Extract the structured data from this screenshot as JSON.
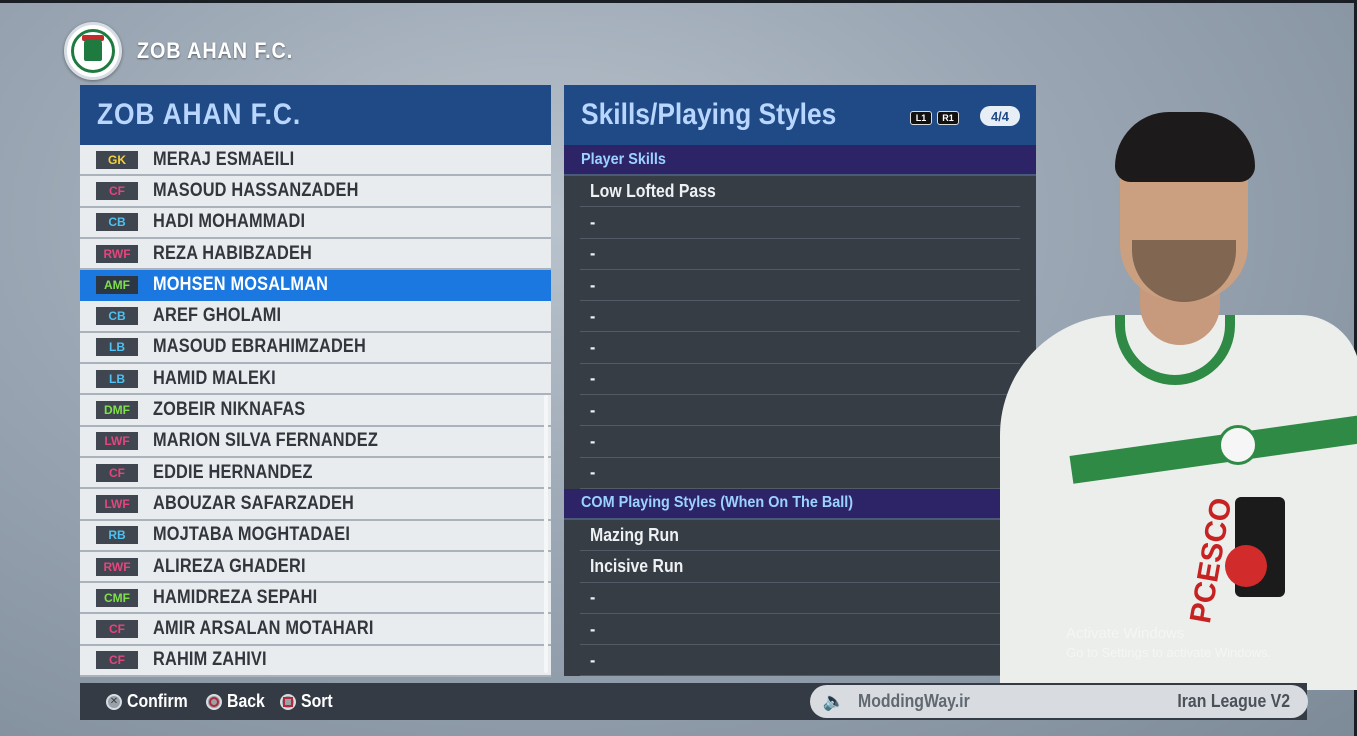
{
  "header": {
    "club_title": "ZOB AHAN F.C."
  },
  "left_panel": {
    "title": "ZOB AHAN F.C.",
    "players": [
      {
        "pos": "GK",
        "pos_color": "#f5d23a",
        "name": "MERAJ ESMAEILI"
      },
      {
        "pos": "CF",
        "pos_color": "#e4457e",
        "name": "MASOUD HASSANZADEH"
      },
      {
        "pos": "CB",
        "pos_color": "#4ec1f2",
        "name": "HADI MOHAMMADI"
      },
      {
        "pos": "RWF",
        "pos_color": "#e4457e",
        "name": "REZA HABIBZADEH"
      },
      {
        "pos": "AMF",
        "pos_color": "#7ee04a",
        "name": "MOHSEN MOSALMAN",
        "selected": true
      },
      {
        "pos": "CB",
        "pos_color": "#4ec1f2",
        "name": "AREF GHOLAMI"
      },
      {
        "pos": "LB",
        "pos_color": "#4ec1f2",
        "name": "MASOUD EBRAHIMZADEH"
      },
      {
        "pos": "LB",
        "pos_color": "#4ec1f2",
        "name": "HAMID MALEKI"
      },
      {
        "pos": "DMF",
        "pos_color": "#7ee04a",
        "name": "ZOBEIR NIKNAFAS"
      },
      {
        "pos": "LWF",
        "pos_color": "#e4457e",
        "name": "MARION SILVA FERNANDEZ"
      },
      {
        "pos": "CF",
        "pos_color": "#e4457e",
        "name": "EDDIE HERNANDEZ"
      },
      {
        "pos": "LWF",
        "pos_color": "#e4457e",
        "name": "ABOUZAR SAFARZADEH"
      },
      {
        "pos": "RB",
        "pos_color": "#4ec1f2",
        "name": "MOJTABA MOGHTADAEI"
      },
      {
        "pos": "RWF",
        "pos_color": "#e4457e",
        "name": "ALIREZA GHADERI"
      },
      {
        "pos": "CMF",
        "pos_color": "#7ee04a",
        "name": "HAMIDREZA SEPAHI"
      },
      {
        "pos": "CF",
        "pos_color": "#e4457e",
        "name": "AMIR ARSALAN MOTAHARI"
      },
      {
        "pos": "CF",
        "pos_color": "#e4457e",
        "name": "RAHIM ZAHIVI"
      }
    ]
  },
  "right_panel": {
    "title": "Skills/Playing Styles",
    "btn_l1": "L1",
    "btn_r1": "R1",
    "page": "4/4",
    "player_skills": {
      "heading": "Player Skills",
      "items": [
        "Low Lofted Pass",
        "-",
        "-",
        "-",
        "-",
        "-",
        "-",
        "-",
        "-",
        "-"
      ]
    },
    "com_styles": {
      "heading": "COM Playing Styles (When On The Ball)",
      "items": [
        "Mazing Run",
        "Incisive Run",
        "-",
        "-",
        "-"
      ]
    }
  },
  "portrait": {
    "sponsor": "PCESCO"
  },
  "watermark": {
    "line1": "Activate Windows",
    "line2": "Go to Settings to activate Windows."
  },
  "bottom_bar": {
    "confirm": "Confirm",
    "back": "Back",
    "sort": "Sort",
    "credit": "ModdingWay.ir",
    "league": "Iran League V2"
  },
  "colors": {
    "panel_header": "#1f4a86",
    "selected_row": "#1a78e0",
    "section_head": "#2c2467"
  }
}
